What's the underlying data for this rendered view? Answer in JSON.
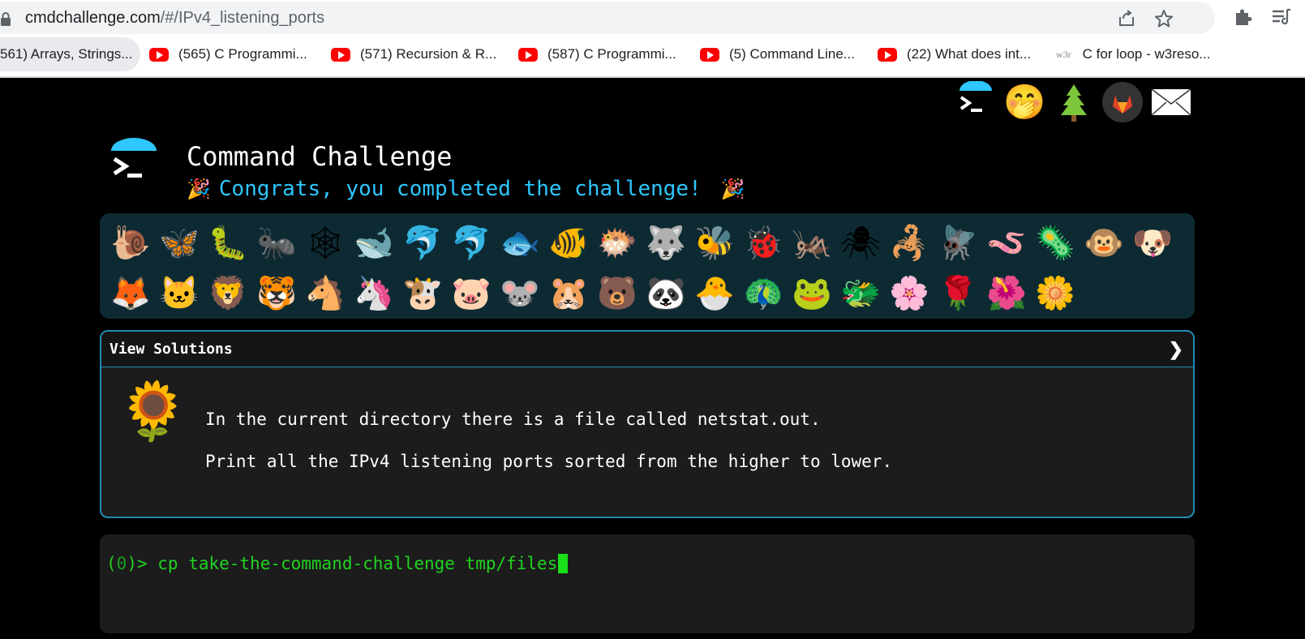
{
  "browser": {
    "url_host": "cmdchallenge.com",
    "url_path": "/#/IPv4_listening_ports",
    "bookmarks": [
      {
        "label": "561) Arrays, Strings...",
        "icon": "youtube-icon"
      },
      {
        "label": "(565) C Programmi...",
        "icon": "youtube-icon"
      },
      {
        "label": "(571) Recursion & R...",
        "icon": "youtube-icon"
      },
      {
        "label": "(587) C Programmi...",
        "icon": "youtube-icon"
      },
      {
        "label": "(5) Command Line...",
        "icon": "youtube-icon"
      },
      {
        "label": "(22) What does int...",
        "icon": "youtube-icon"
      },
      {
        "label": "C for loop - w3reso...",
        "icon": "w3resource-icon",
        "icon_text": "w3r"
      }
    ]
  },
  "header": {
    "title": "Command Challenge",
    "congrats": "Congrats, you completed the challenge!",
    "party_emoji": "🎉"
  },
  "top_icons": [
    "terminal-icon",
    "shush-icon",
    "tree-icon",
    "gitlab-icon",
    "envelope-icon"
  ],
  "emojis": {
    "row1": [
      "🐌",
      "🦋",
      "🐛",
      "🐜",
      "🕸",
      "🐋",
      "🐬",
      "🐬",
      "🐟",
      "🐠",
      "🐡",
      "🐺",
      "🐝",
      "🐞",
      "🦗",
      "🕷",
      "🦂",
      "🪰",
      "🪱",
      "🦠",
      "🐵",
      "🐶"
    ],
    "row2": [
      "🦊",
      "🐱",
      "🦁",
      "🐯",
      "🐴",
      "🦄",
      "🐮",
      "🐷",
      "🐭",
      "🐹",
      "🐻",
      "🐼",
      "🐣",
      "🦚",
      "🐸",
      "🐲",
      "🌸",
      "🌹",
      "🌺",
      "🌼"
    ]
  },
  "solutions": {
    "label": "View Solutions",
    "chevron": "❯",
    "flower": "🌻",
    "line1": "In the current directory there is a file called netstat.out.",
    "line2": "Print all the IPv4 listening ports sorted from the higher to lower."
  },
  "terminal": {
    "prompt_open": "(",
    "prompt_num": "0",
    "prompt_close": ")>",
    "command": "cp take-the-command-challenge tmp/files"
  },
  "colors": {
    "accent": "#2ec7ff",
    "panel_border": "#1f8db6",
    "terminal_green": "#21d321"
  }
}
